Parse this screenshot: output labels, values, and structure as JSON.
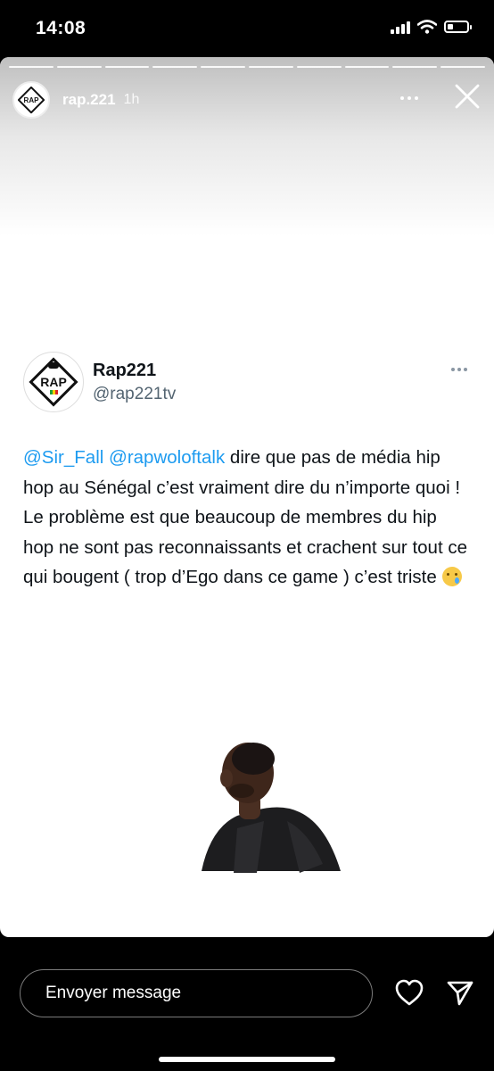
{
  "status_bar": {
    "time": "14:08",
    "icons": [
      "cellular-signal-icon",
      "wifi-icon",
      "battery-icon"
    ],
    "battery_level": 0.3
  },
  "story": {
    "segments_total": 10,
    "segments_viewed": 10,
    "username": "rap.221",
    "posted_ago": "1h",
    "icons": [
      "more-options-icon",
      "close-icon"
    ]
  },
  "tweet": {
    "display_name": "Rap221",
    "handle": "@rap221tv",
    "mention_1": "@Sir_Fall",
    "mention_2": "@rapwoloftalk",
    "text_after_mentions": "dire que pas de média hip hop au Sénégal c’est vraiment dire du n’importe quoi !",
    "text_paragraph_2": "Le problème est que beaucoup de membres du hip hop ne sont pas reconnaissants et crachent sur tout ce qui bougent ( trop d’Ego dans ce game ) c’est triste",
    "emoji": "crying-face-emoji",
    "logo_text": "RAP"
  },
  "footer": {
    "message_placeholder": "Envoyer message",
    "icons": [
      "heart-icon",
      "send-icon"
    ]
  },
  "colors": {
    "mention": "#1d9bf0",
    "handle": "#536471",
    "text": "#0f1419"
  }
}
